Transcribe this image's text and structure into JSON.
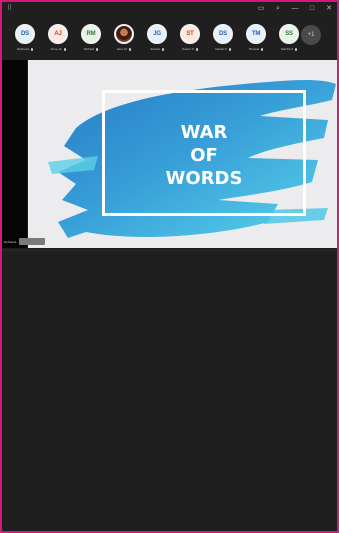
{
  "window": {
    "left_glyph": "⠿",
    "controls": [
      {
        "name": "layout-icon",
        "glyph": "▭"
      },
      {
        "name": "search-icon",
        "glyph": "⌕"
      },
      {
        "name": "minimize-icon",
        "glyph": "—"
      },
      {
        "name": "maximize-icon",
        "glyph": "□"
      },
      {
        "name": "close-icon",
        "glyph": "✕"
      }
    ]
  },
  "participants": [
    {
      "initials": "DS",
      "name": "DeSouza",
      "bg": "#e6f0fb",
      "fg": "#2a5fa8"
    },
    {
      "initials": "AJ",
      "name": "Anne Ja",
      "bg": "#fde9e1",
      "fg": "#c0491f"
    },
    {
      "initials": "RM",
      "name": "Richard",
      "bg": "#e6f3e6",
      "fg": "#357a35"
    },
    {
      "initials": "",
      "name": "Sam Ch",
      "bg": "#7a3e28",
      "fg": "#ffffff",
      "photo": true
    },
    {
      "initials": "JG",
      "name": "Jessica",
      "bg": "#e6f0fb",
      "fg": "#2a5fa8"
    },
    {
      "initials": "ST",
      "name": "Susan Tr",
      "bg": "#fde9e1",
      "fg": "#c0491f"
    },
    {
      "initials": "DS",
      "name": "Daniel S",
      "bg": "#e6f0fb",
      "fg": "#2a5fa8"
    },
    {
      "initials": "TM",
      "name": "Thomas",
      "bg": "#e6f0fb",
      "fg": "#2a5fa8"
    },
    {
      "initials": "SS",
      "name": "Sandra S",
      "bg": "#e6f3e6",
      "fg": "#357a35"
    }
  ],
  "more_button": "+1",
  "stage": {
    "presenter_label": "DeSouza"
  },
  "slide": {
    "title_lines": [
      "WAR",
      "OF",
      "WORDS"
    ],
    "accent": "#3aa7dc",
    "background": "#ececee"
  }
}
